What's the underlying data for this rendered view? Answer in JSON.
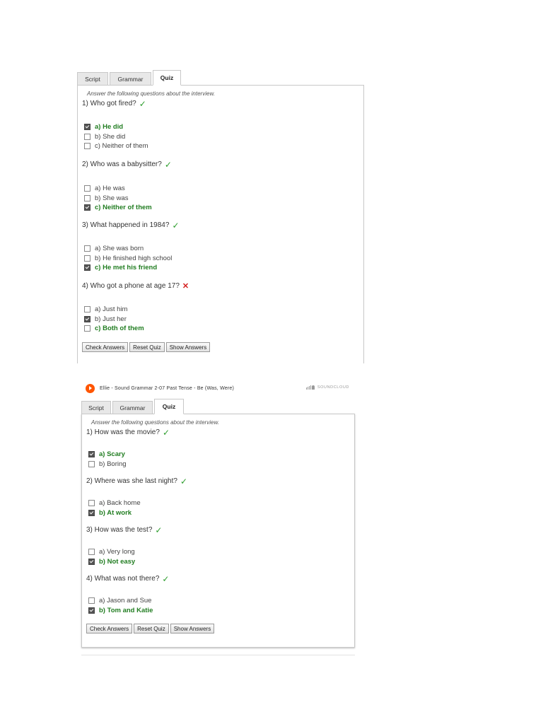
{
  "quiz1": {
    "tabs": [
      "Script",
      "Grammar",
      "Quiz"
    ],
    "instructions": "Answer the following questions about the interview.",
    "questions": [
      {
        "text": "1) Who got fired?",
        "mark": "✓",
        "answers": [
          {
            "text": "a) He did",
            "checked": true,
            "right": true
          },
          {
            "text": "b) She did",
            "checked": false,
            "right": false
          },
          {
            "text": "c) Neither of them",
            "checked": false,
            "right": false
          }
        ]
      },
      {
        "text": "2) Who was a babysitter?",
        "mark": "✓",
        "answers": [
          {
            "text": "a) He was",
            "checked": false,
            "right": false
          },
          {
            "text": "b) She was",
            "checked": false,
            "right": false
          },
          {
            "text": "c) Neither of them",
            "checked": true,
            "right": true
          }
        ]
      },
      {
        "text": "3) What happened in 1984?",
        "mark": "✓",
        "answers": [
          {
            "text": "a) She was born",
            "checked": false,
            "right": false
          },
          {
            "text": "b) He finished high school",
            "checked": false,
            "right": false
          },
          {
            "text": "c) He met his friend",
            "checked": true,
            "right": true
          }
        ]
      },
      {
        "text": "4) Who got a phone at age 17?",
        "mark": "✕",
        "answers": [
          {
            "text": "a) Just him",
            "checked": false,
            "right": false
          },
          {
            "text": "b) Just her",
            "checked": true,
            "right": false
          },
          {
            "text": "c) Both of them",
            "checked": false,
            "right": true
          }
        ]
      }
    ],
    "buttons": [
      "Check Answers",
      "Reset Quiz",
      "Show Answers"
    ]
  },
  "quiz2": {
    "player": {
      "title": "Ellie - Sound Grammar 2-07 Past Tense - Be (Was, Were)",
      "brand": "SOUNDCLOUD"
    },
    "tabs": [
      "Script",
      "Grammar",
      "Quiz"
    ],
    "instructions": "Answer the following questions about the interview.",
    "questions": [
      {
        "text": "1) How was the movie?",
        "mark": "✓",
        "answers": [
          {
            "text": "a) Scary",
            "checked": true,
            "right": true
          },
          {
            "text": "b) Boring",
            "checked": false,
            "right": false
          }
        ]
      },
      {
        "text": "2) Where was she last night?",
        "mark": "✓",
        "answers": [
          {
            "text": "a) Back home",
            "checked": false,
            "right": false
          },
          {
            "text": "b) At work",
            "checked": true,
            "right": true
          }
        ]
      },
      {
        "text": "3) How was the test?",
        "mark": "✓",
        "answers": [
          {
            "text": "a) Very long",
            "checked": false,
            "right": false
          },
          {
            "text": "b) Not easy",
            "checked": true,
            "right": true
          }
        ]
      },
      {
        "text": "4) What was not there?",
        "mark": "✓",
        "answers": [
          {
            "text": "a) Jason and Sue",
            "checked": false,
            "right": false
          },
          {
            "text": "b) Tom and Katie",
            "checked": true,
            "right": true
          }
        ]
      }
    ],
    "buttons": [
      "Check Answers",
      "Reset Quiz",
      "Show Answers"
    ]
  },
  "colors": {
    "correct": "#217d21",
    "check_mark": "#2e9e2e",
    "wrong_mark": "#d42020",
    "play": "#ff5500"
  }
}
